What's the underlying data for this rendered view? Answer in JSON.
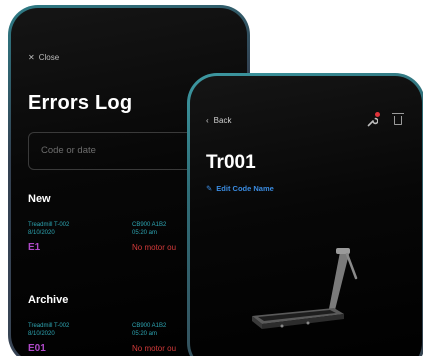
{
  "errors_log": {
    "close_label": "Close",
    "title": "Errors Log",
    "search_placeholder": "Code or date",
    "sections": [
      {
        "title": "New",
        "entries": [
          {
            "device": "Treadmill T-002",
            "date": "8/10/2020",
            "serial": "CB900 A1B2",
            "time": "05:20 am",
            "code": "E1",
            "message": "No motor ou"
          }
        ]
      },
      {
        "title": "Archive",
        "entries": [
          {
            "device": "Treadmill T-002",
            "date": "8/10/2020",
            "serial": "CB900 A1B2",
            "time": "05:20 am",
            "code": "E01",
            "message": "No motor ou"
          }
        ]
      }
    ]
  },
  "code_detail": {
    "back_label": "Back",
    "code_name": "Tr001",
    "edit_label": "Edit Code Name",
    "icons": [
      "wrench-alert-icon",
      "trash-icon"
    ]
  },
  "colors": {
    "accent_teal": "#2ea6b3",
    "error_red": "#d23a3a",
    "code_purple": "#b04ac9",
    "link_blue": "#3a8be0",
    "frame": "#3a4554"
  }
}
